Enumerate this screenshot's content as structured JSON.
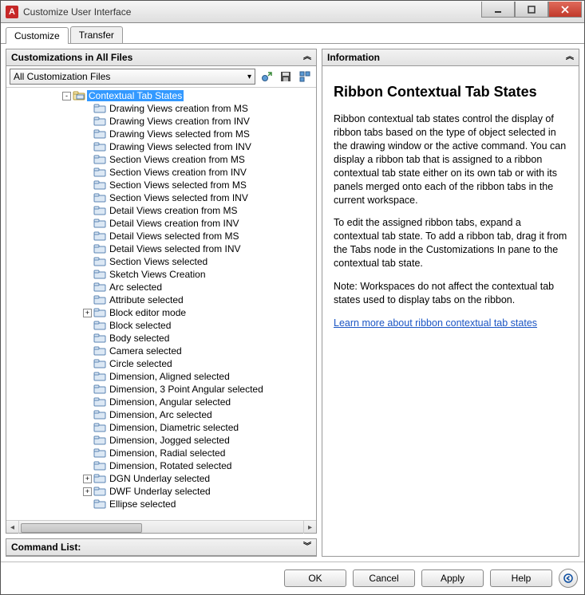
{
  "window": {
    "title": "Customize User Interface",
    "app_icon_letter": "A"
  },
  "tabs": {
    "items": [
      "Customize",
      "Transfer"
    ],
    "selected": 0
  },
  "left_panel": {
    "title": "Customizations in All Files",
    "dropdown": {
      "selected": "All Customization Files"
    },
    "tree": {
      "root": {
        "label": "Contextual Tab States",
        "selected": true,
        "expander": "-"
      },
      "children": [
        {
          "label": "Drawing Views creation from MS"
        },
        {
          "label": "Drawing Views creation from INV"
        },
        {
          "label": "Drawing Views selected from MS"
        },
        {
          "label": "Drawing Views selected from INV"
        },
        {
          "label": "Section Views creation from MS"
        },
        {
          "label": "Section Views creation from INV"
        },
        {
          "label": "Section Views selected from MS"
        },
        {
          "label": "Section Views selected from INV"
        },
        {
          "label": "Detail Views creation from MS"
        },
        {
          "label": "Detail Views creation from INV"
        },
        {
          "label": "Detail Views selected from MS"
        },
        {
          "label": "Detail Views selected from INV"
        },
        {
          "label": "Section Views selected"
        },
        {
          "label": "Sketch Views Creation"
        },
        {
          "label": "Arc selected"
        },
        {
          "label": "Attribute selected"
        },
        {
          "label": "Block editor mode",
          "expander": "+"
        },
        {
          "label": "Block selected"
        },
        {
          "label": "Body selected"
        },
        {
          "label": "Camera selected"
        },
        {
          "label": "Circle selected"
        },
        {
          "label": "Dimension, Aligned selected"
        },
        {
          "label": "Dimension, 3 Point Angular selected"
        },
        {
          "label": "Dimension, Angular selected"
        },
        {
          "label": "Dimension, Arc selected"
        },
        {
          "label": "Dimension, Diametric selected"
        },
        {
          "label": "Dimension, Jogged selected"
        },
        {
          "label": "Dimension, Radial selected"
        },
        {
          "label": "Dimension, Rotated selected"
        },
        {
          "label": "DGN Underlay selected",
          "expander": "+"
        },
        {
          "label": "DWF Underlay selected",
          "expander": "+"
        },
        {
          "label": "Ellipse selected"
        }
      ]
    }
  },
  "command_panel": {
    "title": "Command List:"
  },
  "info_panel": {
    "title": "Information",
    "heading": "Ribbon Contextual Tab States",
    "para1": "Ribbon contextual tab states control the display of ribbon tabs based on the type of object selected in the drawing window or the active command. You can display a ribbon tab that is assigned to a ribbon contextual tab state either on its own tab or with its panels merged onto each of the ribbon tabs in the current workspace.",
    "para2": "To edit the assigned ribbon tabs, expand a contextual tab state. To add a ribbon tab, drag it from the Tabs node in the Customizations In pane to the contextual tab state.",
    "para3": "Note: Workspaces do not affect the contextual tab states used to display tabs on the ribbon.",
    "link": "Learn more about ribbon contextual tab states"
  },
  "footer": {
    "ok": "OK",
    "cancel": "Cancel",
    "apply": "Apply",
    "help": "Help"
  }
}
